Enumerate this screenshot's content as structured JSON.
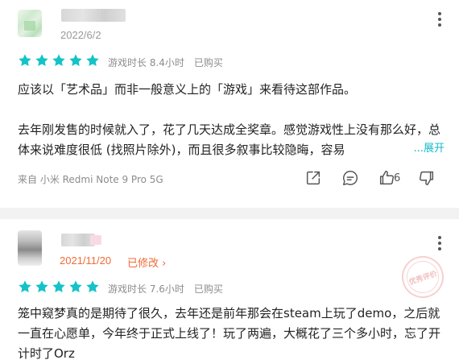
{
  "review1": {
    "date": "2022/6/2",
    "rating": 5,
    "playtime": "游戏时长 8.4小时",
    "status": "已购买",
    "line1": "应该以「艺术品」而非一般意义上的「游戏」来看待这部作品。",
    "line2": "去年刚发售的时候就入了，花了几天达成全奖章。感觉游戏性上没有那么好，总体来说难度很低 (找照片除外)，而且很多叙事比较隐晦，容易",
    "expand": "...展开",
    "device": "来自 小米 Redmi Note 9 Pro 5G",
    "likes": "6"
  },
  "review2": {
    "date": "2021/11/20",
    "modified": "已修改",
    "rating": 5,
    "playtime": "游戏时长 7.6小时",
    "status": "已购买",
    "text": "笼中窥梦真的是期待了很久，去年还是前年那会在steam上玩了demo，之后就一直在心愿单，今年终于正式上线了！玩了两遍，大概花了三个多小时，忘了开计时了Orz",
    "stamp": "优秀评价"
  },
  "colors": {
    "star": "#14c3c8",
    "accent": "#14b9c8",
    "modified": "#f06a36",
    "meta": "#8c8c8c"
  }
}
